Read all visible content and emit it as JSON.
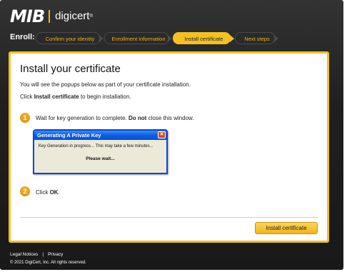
{
  "header": {
    "logo_mib": "MIB",
    "logo_digicert": "digicert",
    "logo_tm": "®"
  },
  "enroll": {
    "label": "Enroll:",
    "steps": [
      {
        "label": "Confirm your identity",
        "active": false
      },
      {
        "label": "Enrollment information",
        "active": false
      },
      {
        "label": "Install certificate",
        "active": true
      },
      {
        "label": "Next steps",
        "active": false
      }
    ]
  },
  "main": {
    "title": "Install your certificate",
    "intro": "You will see the popups below as part of your certificate installation.",
    "click_prefix": "Click ",
    "click_bold": "Install certificate",
    "click_suffix": " to begin installation.",
    "step1": {
      "number": "1",
      "text_prefix": "Wait for key generation to complete. ",
      "text_bold": "Do not",
      "text_suffix": " close this window."
    },
    "dialog": {
      "title": "Generating A Private Key",
      "message": "Key Generation in progress... This may take a few minutes...",
      "wait": "Please wait...",
      "close_glyph": "✕"
    },
    "step2": {
      "number": "2",
      "text_prefix": "Click ",
      "text_bold": "OK",
      "text_suffix": "."
    },
    "install_button": "Install certificate"
  },
  "footer": {
    "legal": "Legal Notices",
    "separator": "|",
    "privacy": "Privacy",
    "copyright": "© 2021 DigiCert, Inc. All rights reserved."
  },
  "colors": {
    "accent": "#f5c022",
    "background": "#1f1f1f",
    "step_text": "#f2b411"
  }
}
